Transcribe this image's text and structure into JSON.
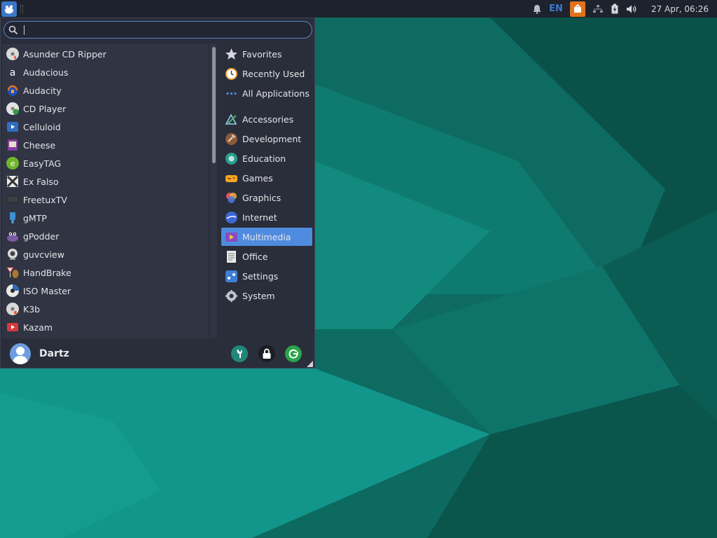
{
  "panel": {
    "language": "EN",
    "clock": "27 Apr, 06:26"
  },
  "search": {
    "value": "",
    "placeholder": ""
  },
  "applications": [
    {
      "label": "Asunder CD Ripper",
      "icon": "asunder-icon"
    },
    {
      "label": "Audacious",
      "icon": "audacious-icon"
    },
    {
      "label": "Audacity",
      "icon": "audacity-icon"
    },
    {
      "label": "CD Player",
      "icon": "cd-player-icon"
    },
    {
      "label": "Celluloid",
      "icon": "celluloid-icon"
    },
    {
      "label": "Cheese",
      "icon": "cheese-icon"
    },
    {
      "label": "EasyTAG",
      "icon": "easytag-icon"
    },
    {
      "label": "Ex Falso",
      "icon": "ex-falso-icon"
    },
    {
      "label": "FreetuxTV",
      "icon": "freetuxtv-icon"
    },
    {
      "label": "gMTP",
      "icon": "gmtp-icon"
    },
    {
      "label": "gPodder",
      "icon": "gpodder-icon"
    },
    {
      "label": "guvcview",
      "icon": "guvcview-icon"
    },
    {
      "label": "HandBrake",
      "icon": "handbrake-icon"
    },
    {
      "label": "ISO Master",
      "icon": "iso-master-icon"
    },
    {
      "label": "K3b",
      "icon": "k3b-icon"
    },
    {
      "label": "Kazam",
      "icon": "kazam-icon"
    }
  ],
  "categories": [
    {
      "label": "Favorites",
      "icon": "star-icon",
      "active": false
    },
    {
      "label": "Recently Used",
      "icon": "clock-icon",
      "active": false
    },
    {
      "label": "All Applications",
      "icon": "grid-dots-icon",
      "active": false
    },
    {
      "label": "Accessories",
      "icon": "accessories-icon",
      "active": false
    },
    {
      "label": "Development",
      "icon": "hammer-icon",
      "active": false
    },
    {
      "label": "Education",
      "icon": "education-icon",
      "active": false
    },
    {
      "label": "Games",
      "icon": "gamepad-icon",
      "active": false
    },
    {
      "label": "Graphics",
      "icon": "graphics-icon",
      "active": false
    },
    {
      "label": "Internet",
      "icon": "globe-icon",
      "active": false
    },
    {
      "label": "Multimedia",
      "icon": "multimedia-icon",
      "active": true
    },
    {
      "label": "Office",
      "icon": "document-icon",
      "active": false
    },
    {
      "label": "Settings",
      "icon": "settings-icon",
      "active": false
    },
    {
      "label": "System",
      "icon": "gear-icon",
      "active": false
    }
  ],
  "user": {
    "name": "Dartz"
  },
  "colors": {
    "accent": "#4f8ce0",
    "panel": "#1e222c",
    "menu_bg": "#2a2e3a",
    "wallpaper": "#0b5c55"
  }
}
